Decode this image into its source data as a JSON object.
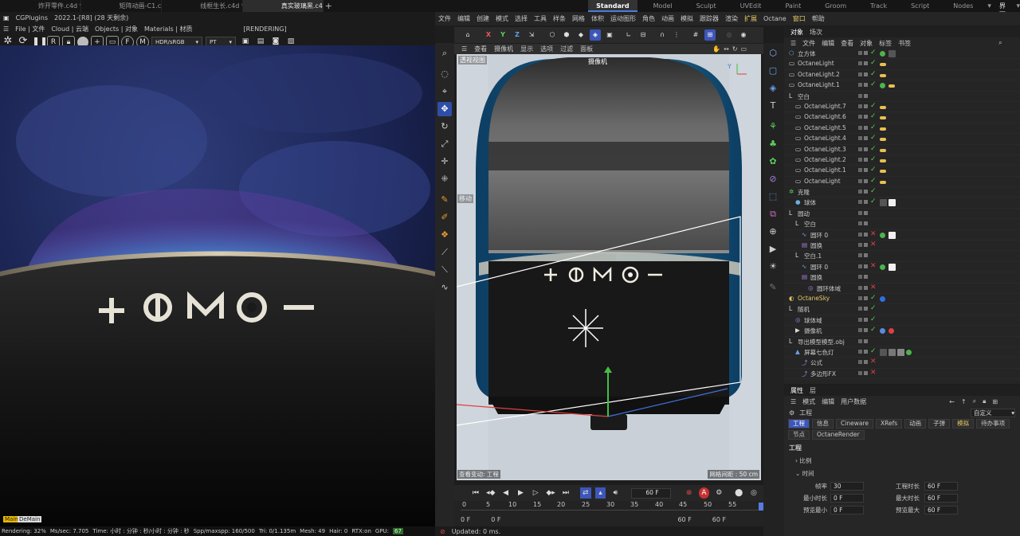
{
  "doc_tabs": [
    {
      "label": "炸开零件.c4d *",
      "active": false
    },
    {
      "label": "矩阵动画-C1.c4d *",
      "active": false
    },
    {
      "label": "线框生长.c4d *",
      "active": false
    },
    {
      "label": "真实玻璃黑.c4d",
      "active": true
    }
  ],
  "add_tab": "+",
  "layouts": [
    {
      "label": "Standard",
      "active": true
    },
    {
      "label": "Model",
      "active": false
    },
    {
      "label": "Sculpt",
      "active": false
    },
    {
      "label": "UVEdit",
      "active": false
    },
    {
      "label": "Paint",
      "active": false
    },
    {
      "label": "Groom",
      "active": false
    },
    {
      "label": "Track",
      "active": false
    },
    {
      "label": "Script",
      "active": false
    },
    {
      "label": "Nodes",
      "active": false
    }
  ],
  "new_layout": "新界面",
  "left": {
    "title": "CGPlugins",
    "version": "2022.1-[R8] (28 天剩余)",
    "menu": [
      "File | 文件",
      "Cloud | 云端",
      "Objects | 对象",
      "Materials | 材质",
      "[RENDERING]"
    ],
    "color_space": "HDR/sRGB",
    "kernel": "PT",
    "render_labels": {
      "plus": "+",
      "power": "Φ",
      "m": "M",
      "minus": "—"
    },
    "status": {
      "rendering": "Rendering: 32%",
      "ms": "Ms/sec: 7.705",
      "time": "Time: 小时 : 分钟 : 秒/小时 : 分钟 : 秒",
      "spp": "Spp/maxspp: 160/500",
      "tri": "Tri: 0/1.135m",
      "mesh": "Mesh: 49",
      "hair": "Hair: 0",
      "rtx": "RTX:on",
      "gpu": "GPU:",
      "gpu_val": "67"
    },
    "badge1": "Main",
    "badge2": "DeMain"
  },
  "menu": [
    "文件",
    "编辑",
    "创建",
    "模式",
    "选择",
    "工具",
    "样条",
    "网格",
    "体积",
    "运动图形",
    "角色",
    "动画",
    "模拟",
    "跟踪器",
    "渲染",
    "扩展",
    "Octane",
    "窗口",
    "帮助"
  ],
  "viewport": {
    "menu": [
      "查看",
      "摄像机",
      "显示",
      "选项",
      "过滤",
      "面板"
    ],
    "label_tl": "透视视图",
    "camera": "摄像机",
    "move": "移动",
    "speed": "查看变动: 工程",
    "grid": "网格间距 : 50 cm",
    "toolbar": [
      "X",
      "Y",
      "Z"
    ]
  },
  "transport": {
    "frame": "60 F"
  },
  "timeline": {
    "ticks": [
      "0",
      "5",
      "10",
      "15",
      "20",
      "25",
      "30",
      "35",
      "40",
      "45",
      "50",
      "55"
    ],
    "start": "0 F",
    "start2": "0 F",
    "end": "60 F",
    "end2": "60 F"
  },
  "updated": "Updated: 0 ms.",
  "objects": {
    "tabs": [
      "对象",
      "场次"
    ],
    "menu": [
      "文件",
      "编辑",
      "查看",
      "对象",
      "标签",
      "书签"
    ],
    "rows": [
      {
        "name": "立方体",
        "indent": 0,
        "type": "cube",
        "status": "check",
        "tags": [
          "green",
          "mat"
        ]
      },
      {
        "name": "OctaneLight",
        "indent": 0,
        "type": "light",
        "status": "check",
        "tags": [
          "yellow"
        ]
      },
      {
        "name": "OctaneLight.2",
        "indent": 0,
        "type": "light",
        "status": "check",
        "tags": [
          "yellow"
        ]
      },
      {
        "name": "OctaneLight.1",
        "indent": 0,
        "type": "light",
        "status": "check",
        "tags": [
          "green",
          "yellow"
        ]
      },
      {
        "name": "空白",
        "indent": 0,
        "type": "null",
        "status": "",
        "tags": []
      },
      {
        "name": "OctaneLight.7",
        "indent": 1,
        "type": "light",
        "status": "check",
        "tags": [
          "yellow"
        ]
      },
      {
        "name": "OctaneLight.6",
        "indent": 1,
        "type": "light",
        "status": "check",
        "tags": [
          "yellow"
        ]
      },
      {
        "name": "OctaneLight.5",
        "indent": 1,
        "type": "light",
        "status": "check",
        "tags": [
          "yellow"
        ]
      },
      {
        "name": "OctaneLight.4",
        "indent": 1,
        "type": "light",
        "status": "check",
        "tags": [
          "yellow"
        ]
      },
      {
        "name": "OctaneLight.3",
        "indent": 1,
        "type": "light",
        "status": "check",
        "tags": [
          "yellow"
        ]
      },
      {
        "name": "OctaneLight.2",
        "indent": 1,
        "type": "light",
        "status": "check",
        "tags": [
          "yellow"
        ]
      },
      {
        "name": "OctaneLight.1",
        "indent": 1,
        "type": "light",
        "status": "check",
        "tags": [
          "yellow"
        ]
      },
      {
        "name": "OctaneLight",
        "indent": 1,
        "type": "light",
        "status": "check",
        "tags": [
          "yellow"
        ]
      },
      {
        "name": "克隆",
        "indent": 0,
        "type": "cloner",
        "status": "check",
        "tags": []
      },
      {
        "name": "球体",
        "indent": 1,
        "type": "sphere",
        "status": "check",
        "tags": [
          "mat",
          "white"
        ]
      },
      {
        "name": "圆动",
        "indent": 0,
        "type": "null",
        "status": "",
        "tags": []
      },
      {
        "name": "空白",
        "indent": 1,
        "type": "null",
        "status": "",
        "tags": []
      },
      {
        "name": "圆环 0",
        "indent": 2,
        "type": "spline",
        "status": "x",
        "tags": [
          "green",
          "white"
        ]
      },
      {
        "name": "圆换",
        "indent": 2,
        "type": "gen",
        "status": "x",
        "tags": []
      },
      {
        "name": "空白.1",
        "indent": 1,
        "type": "null",
        "status": "",
        "tags": []
      },
      {
        "name": "圆环 0",
        "indent": 2,
        "type": "spline",
        "status": "x",
        "tags": [
          "green",
          "white"
        ]
      },
      {
        "name": "圆换",
        "indent": 2,
        "type": "gen",
        "status": "",
        "tags": []
      },
      {
        "name": "圆环体域",
        "indent": 3,
        "type": "field",
        "status": "x",
        "tags": []
      },
      {
        "name": "OctaneSky",
        "indent": 0,
        "type": "sky",
        "status": "check",
        "tags": [
          "blue"
        ]
      },
      {
        "name": "随机",
        "indent": 0,
        "type": "null",
        "status": "check",
        "tags": []
      },
      {
        "name": "球体域",
        "indent": 1,
        "type": "field",
        "status": "check",
        "tags": []
      },
      {
        "name": "摄像机",
        "indent": 1,
        "type": "camera",
        "status": "check",
        "tags": [
          "target",
          "red"
        ]
      },
      {
        "name": "导出模型模型.obj",
        "indent": 0,
        "type": "null",
        "status": "",
        "tags": []
      },
      {
        "name": "屏幕七色灯",
        "indent": 1,
        "type": "mesh",
        "status": "check",
        "tags": [
          "mat",
          "mat2",
          "gray",
          "green"
        ]
      },
      {
        "name": "公式",
        "indent": 2,
        "type": "deformer",
        "status": "x",
        "tags": []
      },
      {
        "name": "多边形FX",
        "indent": 2,
        "type": "deformer",
        "status": "x",
        "tags": []
      }
    ]
  },
  "attributes": {
    "tabs": [
      "属性",
      "层"
    ],
    "menu": [
      "模式",
      "编辑",
      "用户数据"
    ],
    "title": "工程",
    "preset": "自定义",
    "buttons": [
      "工程",
      "信息",
      "Cineware",
      "XRefs",
      "动画",
      "子弹",
      "模拟",
      "待办事项",
      "节点",
      "OctaneRender"
    ],
    "section": "工程",
    "sub1": "比例",
    "sub2": "时间",
    "fields": [
      {
        "label": "帧率",
        "value": "30",
        "label2": "工程时长",
        "value2": "60 F"
      },
      {
        "label": "最小时长",
        "value": "0 F",
        "label2": "最大时长",
        "value2": "60 F"
      },
      {
        "label": "预览最小",
        "value": "0 F",
        "label2": "预览最大",
        "value2": "60 F"
      }
    ]
  },
  "colors": {
    "accent": "#3d56b8",
    "highlight": "#e7c867",
    "check": "#4cd24c",
    "cross": "#e04040"
  }
}
